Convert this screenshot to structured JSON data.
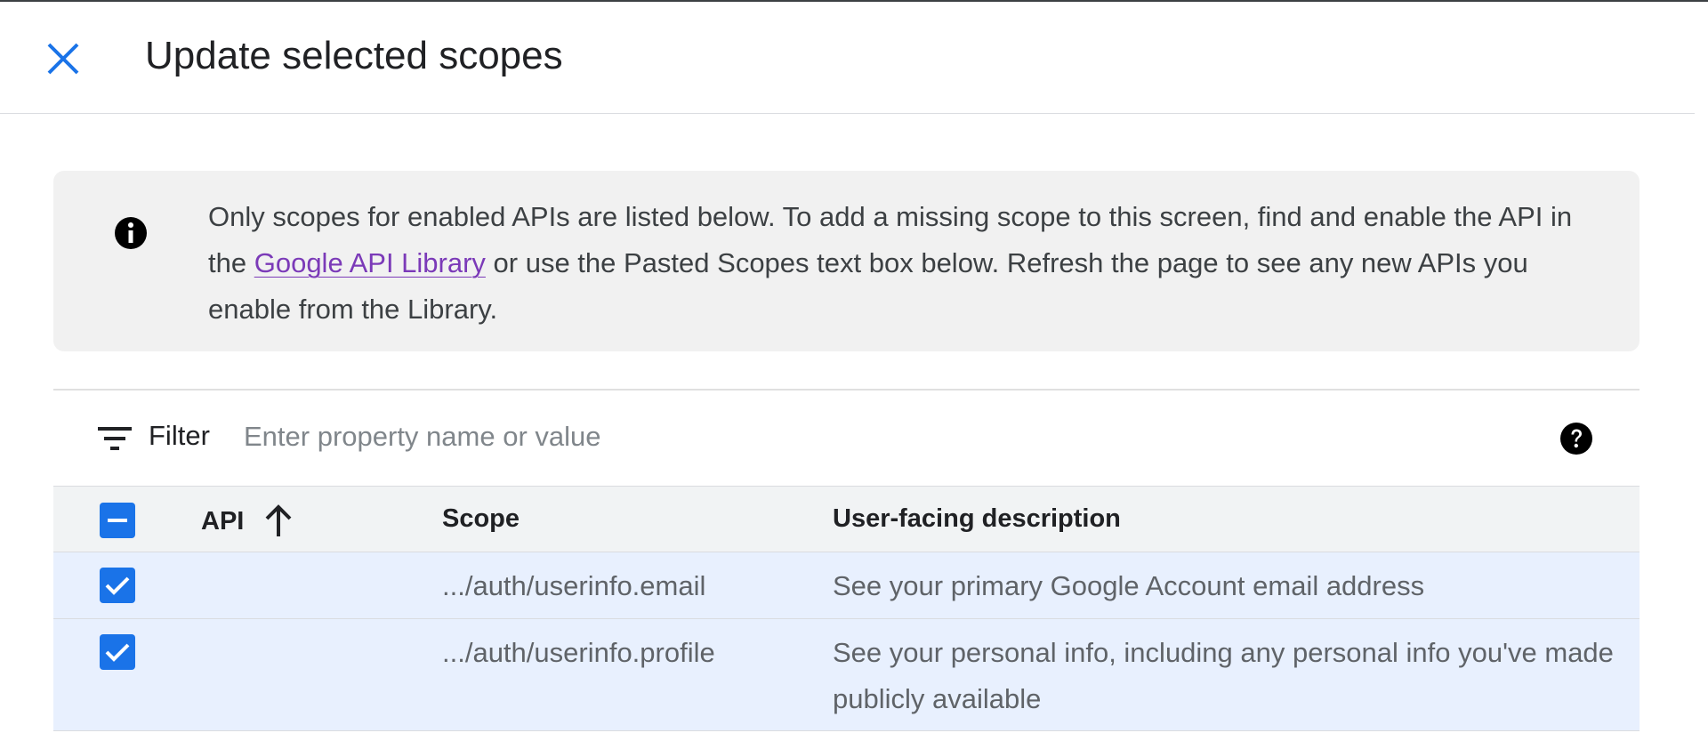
{
  "header": {
    "title": "Update selected scopes"
  },
  "info": {
    "text_before": "Only scopes for enabled APIs are listed below. To add a missing scope to this screen, find and enable the API in the ",
    "link": "Google API Library",
    "text_after": " or use the Pasted Scopes text box below. Refresh the page to see any new APIs you enable from the Library."
  },
  "filter": {
    "label": "Filter",
    "placeholder": "Enter property name or value"
  },
  "table": {
    "columns": {
      "api": "API",
      "scope": "Scope",
      "description": "User-facing description"
    },
    "rows": [
      {
        "api": "",
        "scope": ".../auth/userinfo.email",
        "description": "See your primary Google Account email address",
        "checked": true
      },
      {
        "api": "",
        "scope": ".../auth/userinfo.profile",
        "description": "See your personal info, including any personal info you've made publicly available",
        "checked": true
      }
    ]
  },
  "icons": {
    "close": "close-icon",
    "info": "info-icon",
    "filter": "filter-icon",
    "help": "help-icon",
    "sort": "arrow-up-icon"
  },
  "colors": {
    "accent": "#1a73e8",
    "link": "#7b3ab8",
    "selected_row": "#e8f0fe"
  }
}
